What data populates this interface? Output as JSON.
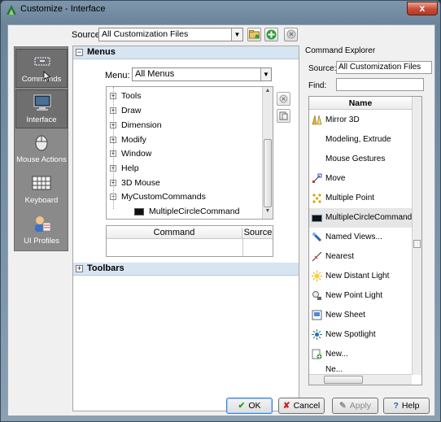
{
  "window": {
    "title": "Customize - Interface",
    "close": "x"
  },
  "source_row": {
    "label": "Source:",
    "value": "All Customization Files"
  },
  "nav": [
    {
      "label": "Commands",
      "selected": true
    },
    {
      "label": "Interface",
      "selected": true
    },
    {
      "label": "Mouse Actions",
      "selected": false
    },
    {
      "label": "Keyboard",
      "selected": false
    },
    {
      "label": "UI Profiles",
      "selected": false
    }
  ],
  "menus_section": {
    "title": "Menus",
    "menu_label": "Menu:",
    "menu_value": "All Menus"
  },
  "tree": [
    {
      "label": "Tools",
      "expander": "+"
    },
    {
      "label": "Draw",
      "expander": "+"
    },
    {
      "label": "Dimension",
      "expander": "+"
    },
    {
      "label": "Modify",
      "expander": "+"
    },
    {
      "label": "Window",
      "expander": "+"
    },
    {
      "label": "Help",
      "expander": "+"
    },
    {
      "label": "3D Mouse",
      "expander": "+"
    },
    {
      "label": "MyCustomCommands",
      "expander": "−"
    },
    {
      "label": "MultipleCircleCommand",
      "expander": ""
    }
  ],
  "command_table": {
    "col1": "Command",
    "col2": "Source"
  },
  "toolbars_section": {
    "title": "Toolbars"
  },
  "explorer": {
    "title": "Command Explorer",
    "source_label": "Source:",
    "source_value": "All Customization Files",
    "find_label": "Find:",
    "column": "Name",
    "items": [
      {
        "label": "Mirror 3D",
        "icon": "mirror3d-icon"
      },
      {
        "label": "Modeling, Extrude",
        "icon": ""
      },
      {
        "label": "Mouse Gestures",
        "icon": ""
      },
      {
        "label": "Move",
        "icon": "move-icon"
      },
      {
        "label": "Multiple Point",
        "icon": "multipoint-icon"
      },
      {
        "label": "MultipleCircleCommand",
        "icon": "black-rect-icon"
      },
      {
        "label": "Named Views...",
        "icon": "named-views-icon"
      },
      {
        "label": "Nearest",
        "icon": "nearest-icon"
      },
      {
        "label": "New Distant Light",
        "icon": "distant-light-icon"
      },
      {
        "label": "New Point Light",
        "icon": "point-light-icon"
      },
      {
        "label": "New Sheet",
        "icon": "new-sheet-icon"
      },
      {
        "label": "New Spotlight",
        "icon": "spotlight-icon"
      },
      {
        "label": "New...",
        "icon": "new-icon"
      },
      {
        "label": "Ne...",
        "icon": ""
      }
    ]
  },
  "footer": {
    "ok": "OK",
    "cancel": "Cancel",
    "apply": "Apply",
    "help": "Help"
  }
}
